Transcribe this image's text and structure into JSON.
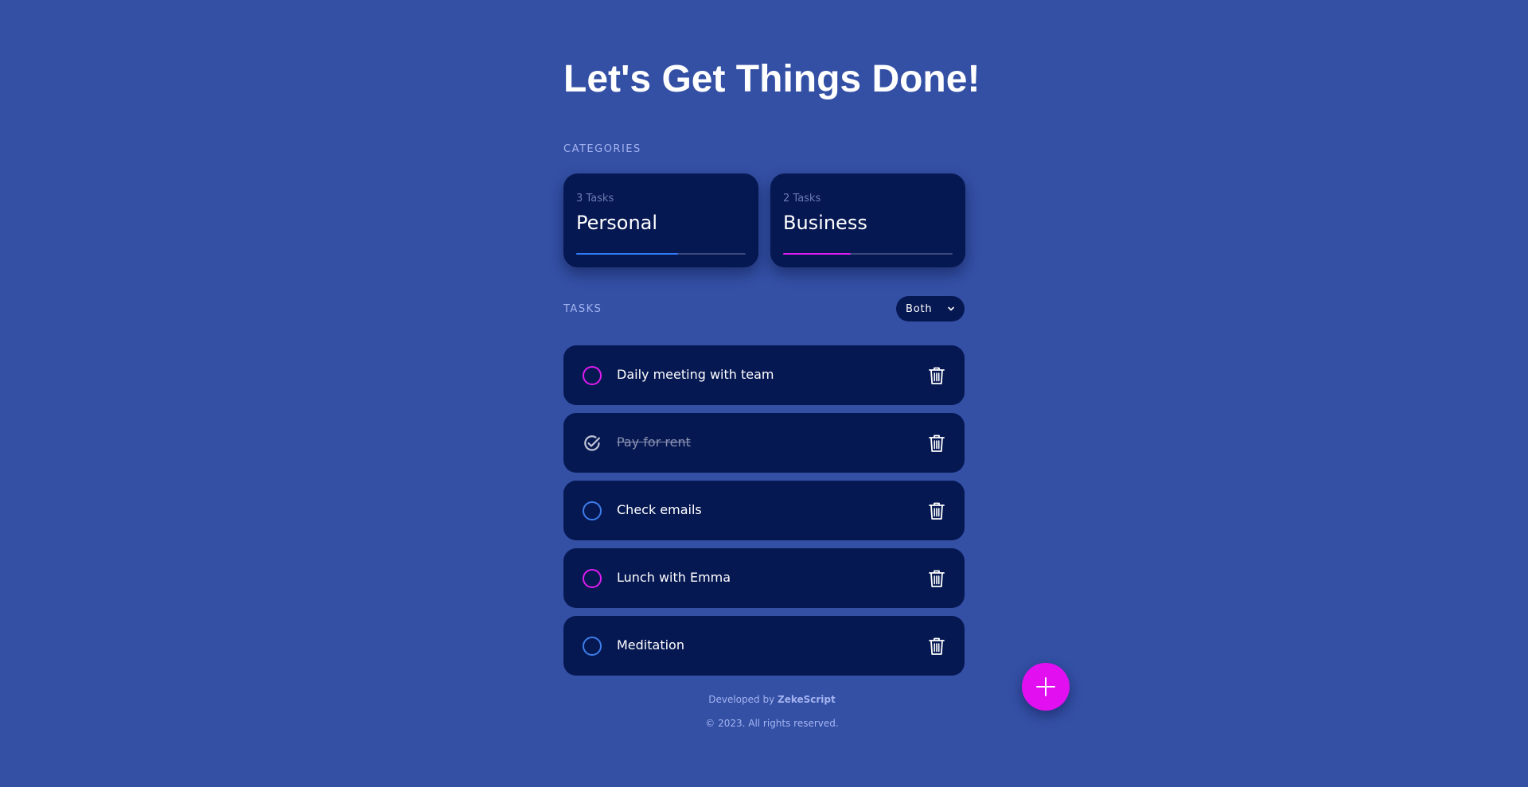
{
  "header": {
    "title": "Let's Get Things Done!"
  },
  "categories": {
    "label": "CATEGORIES",
    "items": [
      {
        "count": "3 Tasks",
        "name": "Personal",
        "progress": 0.6,
        "color": "#2f7cf6"
      },
      {
        "count": "2 Tasks",
        "name": "Business",
        "progress": 0.4,
        "color": "#e01cf0"
      }
    ]
  },
  "tasks": {
    "label": "TASKS",
    "filter": {
      "selected": "Both"
    },
    "items": [
      {
        "text": "Daily meeting with team",
        "done": false,
        "category_color": "#e01cf0"
      },
      {
        "text": "Pay for rent",
        "done": true,
        "category_color": "#c0c4d6"
      },
      {
        "text": "Check emails",
        "done": false,
        "category_color": "#3d7dea"
      },
      {
        "text": "Lunch with Emma",
        "done": false,
        "category_color": "#e01cf0"
      },
      {
        "text": "Meditation",
        "done": false,
        "category_color": "#3d7dea"
      }
    ]
  },
  "footer": {
    "developed_prefix": "Developed by",
    "developer": "ZekeScript",
    "copyright": "© 2023. All rights reserved."
  },
  "colors": {
    "background": "#3450a5",
    "card": "#061852",
    "accent_pink": "#e20ff0",
    "accent_blue": "#2f7cf6"
  },
  "icons": {
    "check": "circle-icon",
    "done": "check-circle-icon",
    "delete": "trash-icon",
    "add": "plus-icon",
    "dropdown": "chevron-down-icon"
  }
}
